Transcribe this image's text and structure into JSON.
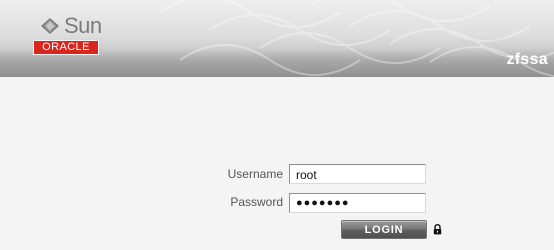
{
  "header": {
    "sun_text": "Sun",
    "oracle_text": "ORACLE",
    "host": "zfssa",
    "brand_color": "#d8261e"
  },
  "login_form": {
    "username_label": "Username",
    "username_value": "root",
    "password_label": "Password",
    "password_value": "●●●●●●●",
    "button_label": "LOGIN",
    "lock_icon": "lock-icon"
  }
}
